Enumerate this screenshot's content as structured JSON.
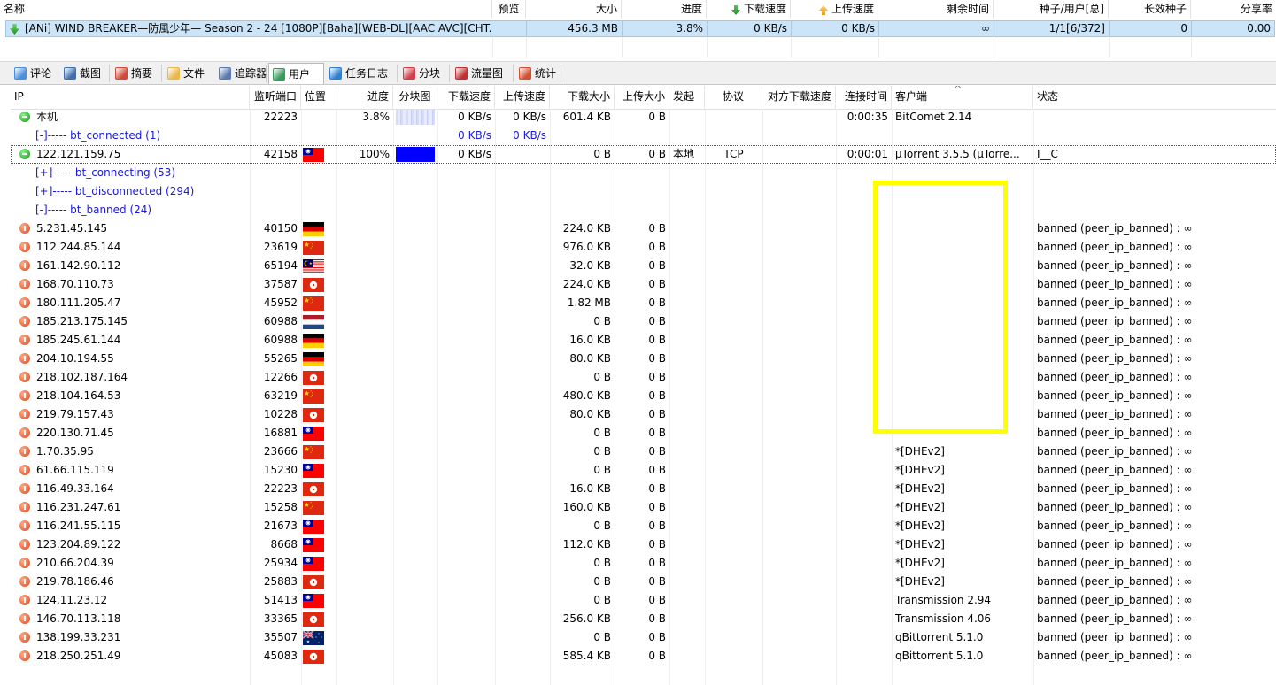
{
  "task_list": {
    "headers": {
      "name": "名称",
      "preview": "预览",
      "size": "大小",
      "progress": "进度",
      "down_speed": "下载速度",
      "up_speed": "上传速度",
      "remaining": "剩余时间",
      "seeds_peers": "种子/用户[总]",
      "long_seeds": "长效种子",
      "ratio": "分享率"
    },
    "row": {
      "name": "[ANi] WIND BREAKER—防風少年— Season 2 - 24 [1080P][Baha][WEB-DL][AAC AVC][CHT...",
      "size": "456.3 MB",
      "progress": "3.8%",
      "down_speed": "0 KB/s",
      "up_speed": "0 KB/s",
      "remaining": "∞",
      "seeds_peers": "1/1[6/372]",
      "long_seeds": "0",
      "ratio": "0.00"
    }
  },
  "tabs": [
    {
      "label": "评论",
      "icon": "comment-icon"
    },
    {
      "label": "截图",
      "icon": "screenshot-icon"
    },
    {
      "label": "摘要",
      "icon": "summary-icon"
    },
    {
      "label": "文件",
      "icon": "file-icon"
    },
    {
      "label": "追踪器",
      "icon": "tracker-icon"
    },
    {
      "label": "用户",
      "icon": "users-icon",
      "active": true
    },
    {
      "label": "任务日志",
      "icon": "log-icon"
    },
    {
      "label": "分块",
      "icon": "pieces-icon"
    },
    {
      "label": "流量图",
      "icon": "traffic-chart-icon"
    },
    {
      "label": "统计",
      "icon": "stats-icon"
    }
  ],
  "peer_headers": {
    "ip": "IP",
    "port": "监听端口",
    "location": "位置",
    "progress": "进度",
    "piece_map": "分块图",
    "down_speed": "下载速度",
    "up_speed": "上传速度",
    "downloaded": "下载大小",
    "uploaded": "上传大小",
    "initiator": "发起",
    "protocol": "协议",
    "remote_down": "对方下载速度",
    "conn_time": "连接时间",
    "client": "客户端",
    "status": "状态",
    "sort_arrow": "^"
  },
  "self_row": {
    "ip": "本机",
    "port": "22223",
    "progress": "3.8%",
    "down_speed": "0 KB/s",
    "up_speed": "0 KB/s",
    "downloaded": "601.4 KB",
    "uploaded": "0 B",
    "conn_time": "0:00:35",
    "client": "BitComet 2.14"
  },
  "connected_group": {
    "label": "[-]----- bt_connected (1)",
    "down_speed": "0 KB/s",
    "up_speed": "0 KB/s"
  },
  "connected_peer": {
    "ip": "122.121.159.75",
    "port": "42158",
    "flag": "tw",
    "progress": "100%",
    "down_speed": "0 KB/s",
    "downloaded": "0 B",
    "uploaded": "0 B",
    "initiator": "本地",
    "protocol": "TCP",
    "conn_time": "0:00:01",
    "client": "µTorrent 3.5.5 (µTorre...",
    "status": "I__C"
  },
  "groups": [
    "[+]----- bt_connecting (53)",
    "[+]----- bt_disconnected (294)",
    "[-]----- bt_banned (24)"
  ],
  "banned_peers": [
    {
      "ip": "5.231.45.145",
      "port": "40150",
      "flag": "de",
      "downloaded": "224.0 KB",
      "uploaded": "0 B",
      "client": "",
      "status": "banned (peer_ip_banned) : ∞"
    },
    {
      "ip": "112.244.85.144",
      "port": "23619",
      "flag": "cn",
      "downloaded": "976.0 KB",
      "uploaded": "0 B",
      "client": "",
      "status": "banned (peer_ip_banned) : ∞"
    },
    {
      "ip": "161.142.90.112",
      "port": "65194",
      "flag": "my",
      "downloaded": "32.0 KB",
      "uploaded": "0 B",
      "client": "",
      "status": "banned (peer_ip_banned) : ∞"
    },
    {
      "ip": "168.70.110.73",
      "port": "37587",
      "flag": "hk",
      "downloaded": "224.0 KB",
      "uploaded": "0 B",
      "client": "",
      "status": "banned (peer_ip_banned) : ∞"
    },
    {
      "ip": "180.111.205.47",
      "port": "45952",
      "flag": "cn",
      "downloaded": "1.82 MB",
      "uploaded": "0 B",
      "client": "",
      "status": "banned (peer_ip_banned) : ∞"
    },
    {
      "ip": "185.213.175.145",
      "port": "60988",
      "flag": "nl",
      "downloaded": "0 B",
      "uploaded": "0 B",
      "client": "",
      "status": "banned (peer_ip_banned) : ∞"
    },
    {
      "ip": "185.245.61.144",
      "port": "60988",
      "flag": "de",
      "downloaded": "16.0 KB",
      "uploaded": "0 B",
      "client": "",
      "status": "banned (peer_ip_banned) : ∞"
    },
    {
      "ip": "204.10.194.55",
      "port": "55265",
      "flag": "de",
      "downloaded": "80.0 KB",
      "uploaded": "0 B",
      "client": "",
      "status": "banned (peer_ip_banned) : ∞"
    },
    {
      "ip": "218.102.187.164",
      "port": "12266",
      "flag": "hk",
      "downloaded": "0 B",
      "uploaded": "0 B",
      "client": "",
      "status": "banned (peer_ip_banned) : ∞"
    },
    {
      "ip": "218.104.164.53",
      "port": "63219",
      "flag": "cn",
      "downloaded": "480.0 KB",
      "uploaded": "0 B",
      "client": "",
      "status": "banned (peer_ip_banned) : ∞"
    },
    {
      "ip": "219.79.157.43",
      "port": "10228",
      "flag": "hk",
      "downloaded": "80.0 KB",
      "uploaded": "0 B",
      "client": "",
      "status": "banned (peer_ip_banned) : ∞"
    },
    {
      "ip": "220.130.71.45",
      "port": "16881",
      "flag": "tw",
      "downloaded": "0 B",
      "uploaded": "0 B",
      "client": "",
      "status": "banned (peer_ip_banned) : ∞"
    },
    {
      "ip": "1.70.35.95",
      "port": "23666",
      "flag": "cn",
      "downloaded": "0 B",
      "uploaded": "0 B",
      "client": "*[DHEv2]",
      "status": "banned (peer_ip_banned) : ∞"
    },
    {
      "ip": "61.66.115.119",
      "port": "15230",
      "flag": "tw",
      "downloaded": "0 B",
      "uploaded": "0 B",
      "client": "*[DHEv2]",
      "status": "banned (peer_ip_banned) : ∞"
    },
    {
      "ip": "116.49.33.164",
      "port": "22223",
      "flag": "hk",
      "downloaded": "16.0 KB",
      "uploaded": "0 B",
      "client": "*[DHEv2]",
      "status": "banned (peer_ip_banned) : ∞"
    },
    {
      "ip": "116.231.247.61",
      "port": "15258",
      "flag": "cn",
      "downloaded": "160.0 KB",
      "uploaded": "0 B",
      "client": "*[DHEv2]",
      "status": "banned (peer_ip_banned) : ∞"
    },
    {
      "ip": "116.241.55.115",
      "port": "21673",
      "flag": "tw",
      "downloaded": "0 B",
      "uploaded": "0 B",
      "client": "*[DHEv2]",
      "status": "banned (peer_ip_banned) : ∞"
    },
    {
      "ip": "123.204.89.122",
      "port": "8668",
      "flag": "tw",
      "downloaded": "112.0 KB",
      "uploaded": "0 B",
      "client": "*[DHEv2]",
      "status": "banned (peer_ip_banned) : ∞"
    },
    {
      "ip": "210.66.204.39",
      "port": "25934",
      "flag": "tw",
      "downloaded": "0 B",
      "uploaded": "0 B",
      "client": "*[DHEv2]",
      "status": "banned (peer_ip_banned) : ∞"
    },
    {
      "ip": "219.78.186.46",
      "port": "25883",
      "flag": "hk",
      "downloaded": "0 B",
      "uploaded": "0 B",
      "client": "*[DHEv2]",
      "status": "banned (peer_ip_banned) : ∞"
    },
    {
      "ip": "124.11.23.12",
      "port": "51413",
      "flag": "tw",
      "downloaded": "0 B",
      "uploaded": "0 B",
      "client": "Transmission 2.94",
      "status": "banned (peer_ip_banned) : ∞"
    },
    {
      "ip": "146.70.113.118",
      "port": "33365",
      "flag": "hk",
      "downloaded": "256.0 KB",
      "uploaded": "0 B",
      "client": "Transmission 4.06",
      "status": "banned (peer_ip_banned) : ∞"
    },
    {
      "ip": "138.199.33.231",
      "port": "35507",
      "flag": "au",
      "downloaded": "0 B",
      "uploaded": "0 B",
      "client": "qBittorrent 5.1.0",
      "status": "banned (peer_ip_banned) : ∞"
    },
    {
      "ip": "218.250.251.49",
      "port": "45083",
      "flag": "hk",
      "downloaded": "585.4 KB",
      "uploaded": "0 B",
      "client": "qBittorrent 5.1.0",
      "status": "banned (peer_ip_banned) : ∞"
    }
  ],
  "colors": {
    "selection": "#cce4f7",
    "group_text": "#1a1ad6",
    "highlight": "#ffff00",
    "piece_fill": "#0000ff"
  }
}
